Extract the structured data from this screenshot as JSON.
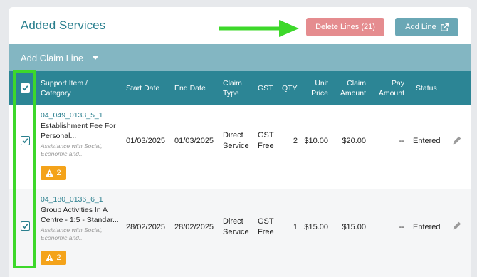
{
  "section": {
    "title": "Added Services"
  },
  "toolbar": {
    "delete_label": "Delete Lines (21)",
    "add_label": "Add Line",
    "add_claim_label": "Add Claim Line"
  },
  "table": {
    "headers": {
      "support_item": "Support Item / Category",
      "start_date": "Start Date",
      "end_date": "End Date",
      "claim_type": "Claim Type",
      "gst": "GST",
      "qty": "QTY",
      "unit_price": "Unit Price",
      "claim_amount": "Claim Amount",
      "pay_amount": "Pay Amount",
      "status": "Status"
    },
    "rows": [
      {
        "checked": true,
        "code": "04_049_0133_5_1",
        "description": "Establishment Fee For Personal...",
        "category": "Assistance with Social, Economic and...",
        "warnings": "2",
        "start_date": "01/03/2025",
        "end_date": "01/03/2025",
        "claim_type": "Direct Service",
        "gst": "GST Free",
        "qty": "2",
        "unit_price": "$10.00",
        "claim_amount": "$20.00",
        "pay_amount": "--",
        "status": "Entered"
      },
      {
        "checked": true,
        "code": "04_180_0136_6_1",
        "description": "Group Activities In A Centre - 1:5 - Standar...",
        "category": "Assistance with Social, Economic and...",
        "warnings": "2",
        "start_date": "28/02/2025",
        "end_date": "28/02/2025",
        "claim_type": "Direct Service",
        "gst": "GST Free",
        "qty": "1",
        "unit_price": "$15.00",
        "claim_amount": "$15.00",
        "pay_amount": "--",
        "status": "Entered"
      }
    ]
  },
  "colors": {
    "accent": "#2a7f8e",
    "header_bg": "#2c8595",
    "claim_bar_bg": "#83b6c2",
    "delete_bg": "#e58c8f",
    "add_bg": "#6aa7b5",
    "warning": "#f4a31a",
    "highlight": "#3dd82a"
  },
  "icons": {
    "add_line": "external-link-icon",
    "add_claim": "chevron-down-icon",
    "warning": "warning-triangle-icon",
    "edit": "pencil-icon",
    "checkbox": "checkmark-icon"
  }
}
